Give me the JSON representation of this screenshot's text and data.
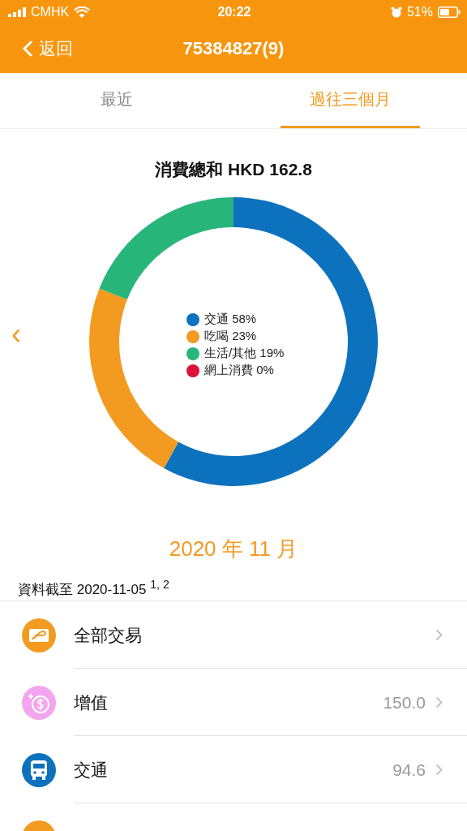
{
  "status_bar": {
    "carrier": "CMHK",
    "time": "20:22",
    "battery": "51%"
  },
  "nav": {
    "back": "返回",
    "title": "75384827(9)"
  },
  "tabs": [
    {
      "label": "最近",
      "selected": false
    },
    {
      "label": "過往三個月",
      "selected": true
    }
  ],
  "summary": {
    "title": "消費總和 HKD 162.8",
    "chart_data": {
      "type": "donut",
      "categories": [
        "交通",
        "吃喝",
        "生活/其他",
        "網上消費"
      ],
      "values": [
        58,
        23,
        19,
        0
      ],
      "value_labels": [
        "58%",
        "23%",
        "19%",
        "0%"
      ],
      "legend": "center"
    },
    "legend": [
      {
        "color": "#0d72bd"
      },
      {
        "color": "#f39a21"
      },
      {
        "color": "#27b57a"
      },
      {
        "color": "#dc143c"
      }
    ]
  },
  "prev": "‹",
  "month": "2020 年 11 月",
  "as_of": "資料截至 2020-11-05 $^{1, 2}$",
  "rows": [
    {
      "kind": "card",
      "label": "全部交易"
    },
    {
      "kind": "topup",
      "label": "增值",
      "amount": "150.0"
    },
    {
      "kind": "bus",
      "label": "交通",
      "amount": "94.6"
    },
    {
      "kind": "partial"
    }
  ]
}
